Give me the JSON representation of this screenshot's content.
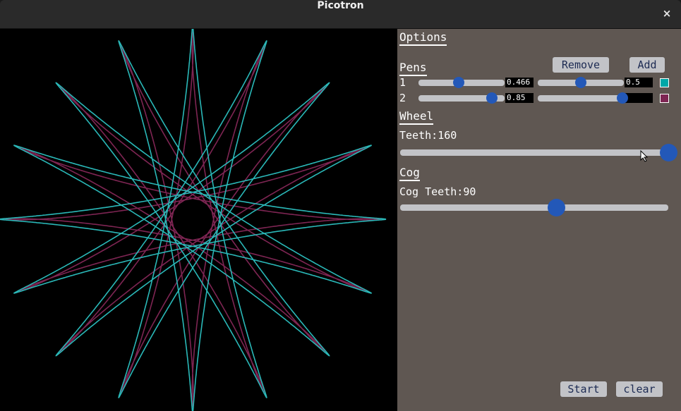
{
  "window": {
    "title": "Picotron",
    "close_glyph": "×"
  },
  "options": {
    "heading": "Options",
    "pens": {
      "heading": "Pens",
      "remove_label": "Remove",
      "add_label": "Add",
      "items": [
        {
          "index": "1",
          "slider1_value": 0.466,
          "slider1_text": "0.466",
          "slider2_value": 0.5,
          "slider2_text": "0.5",
          "color": "#00a8a8"
        },
        {
          "index": "2",
          "slider1_value": 0.85,
          "slider1_text": "0.85",
          "slider2_value": 0.98,
          "slider2_text": "",
          "color": "#7e2553"
        }
      ]
    },
    "wheel": {
      "heading": "Wheel",
      "teeth_label": "Teeth:",
      "teeth": "160",
      "level": 1.0
    },
    "cog": {
      "heading": "Cog",
      "teeth_label": "Cog Teeth:",
      "teeth": "90",
      "level": 0.584
    },
    "start_label": "Start",
    "clear_label": "clear"
  },
  "theme": {
    "panel_bg": "#5f5752",
    "button_bg": "#c2c3c7",
    "button_text": "#1d2b53",
    "knob": "#2358b8",
    "pen1_color": "#2ab8b8",
    "pen2_color": "#7e2553"
  },
  "icons": {
    "cursor": "mouse-pointer-icon",
    "close": "close-icon"
  }
}
